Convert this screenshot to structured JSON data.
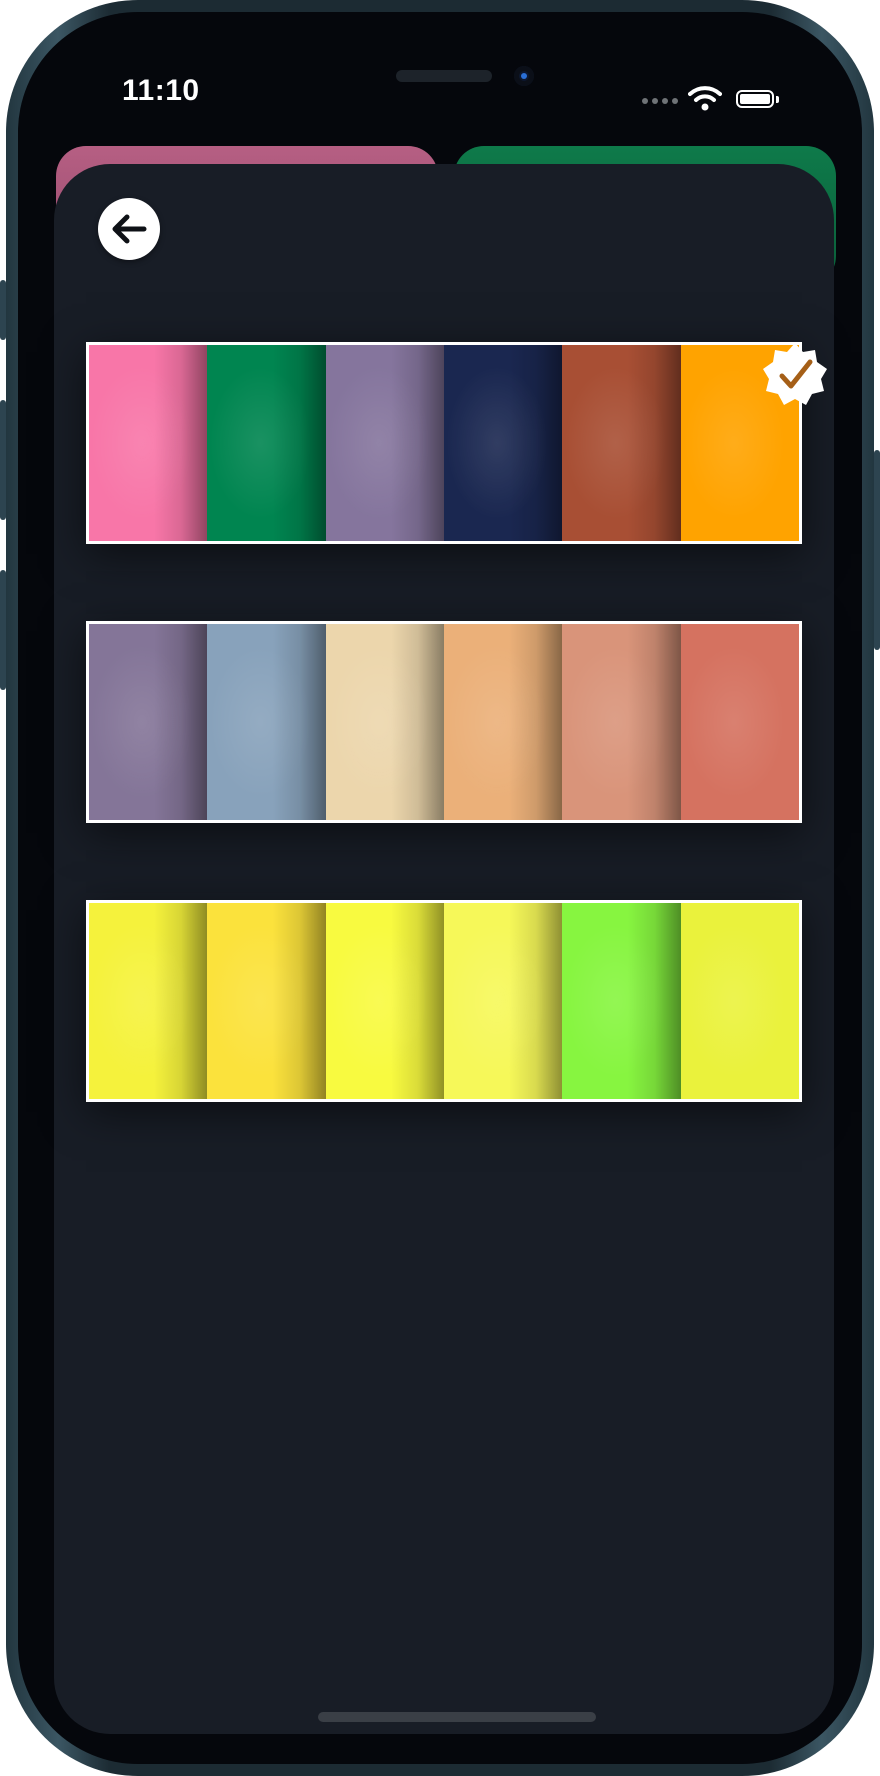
{
  "status_bar": {
    "time": "11:10",
    "icons": [
      "cellular-signal-icon",
      "wifi-icon",
      "battery-icon"
    ]
  },
  "background_cards": [
    {
      "color": "#a9557a"
    },
    {
      "color": "#0b6d41"
    }
  ],
  "header": {
    "back_icon": "arrow-left-icon"
  },
  "palettes": [
    {
      "selected": true,
      "colors": [
        "#f876a8",
        "#008550",
        "#85759d",
        "#1a2750",
        "#a84f34",
        "#ffa300"
      ]
    },
    {
      "selected": false,
      "colors": [
        "#847598",
        "#88a2bb",
        "#ecd6ac",
        "#ebb079",
        "#d9947a",
        "#d57260"
      ]
    },
    {
      "selected": false,
      "colors": [
        "#f5f23c",
        "#fbe23c",
        "#f8fa40",
        "#f6f859",
        "#87f540",
        "#eaf23c"
      ]
    }
  ],
  "badge": {
    "icon": "checkmark-seal-icon",
    "color": "#a55f17"
  }
}
